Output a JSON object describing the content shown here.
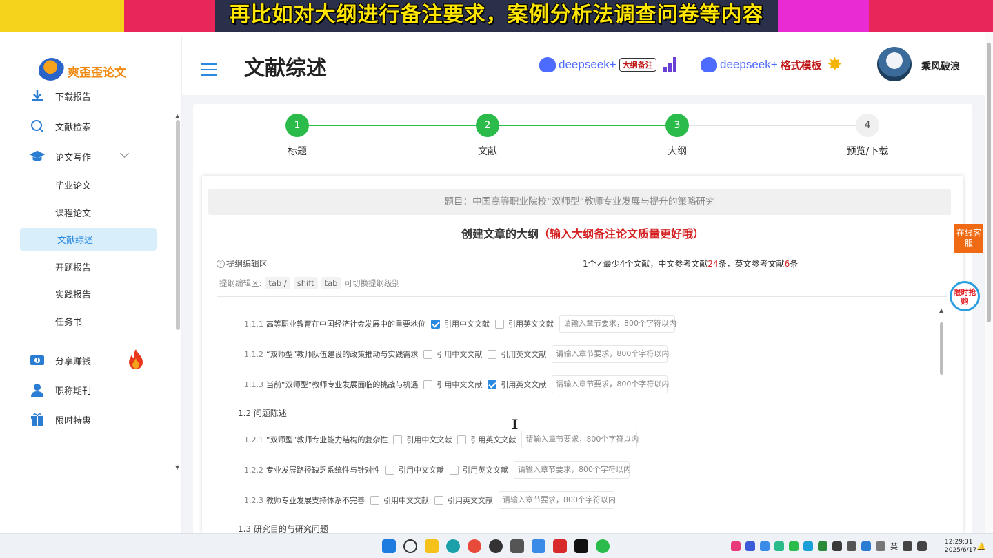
{
  "banner": {
    "caption": "再比如对大纲进行备注要求，案例分析法调查问卷等内容"
  },
  "sidebar": {
    "logo_text": "爽歪歪论文",
    "items": [
      {
        "label": "下载报告",
        "icon": "download-icon"
      },
      {
        "label": "文献检索",
        "icon": "search-icon"
      },
      {
        "label": "论文写作",
        "icon": "graduation-cap-icon"
      }
    ],
    "sub_items": [
      {
        "label": "毕业论文"
      },
      {
        "label": "课程论文"
      },
      {
        "label": "文献综述",
        "active": true
      },
      {
        "label": "开题报告"
      },
      {
        "label": "实践报告"
      },
      {
        "label": "任务书"
      }
    ],
    "bottom_items": [
      {
        "label": "分享赚钱",
        "icon": "money-icon"
      },
      {
        "label": "职称期刊",
        "icon": "user-icon"
      },
      {
        "label": "限时特惠",
        "icon": "gift-icon"
      }
    ]
  },
  "header": {
    "title": "文献综述",
    "badge1": {
      "brand": "deepseek+",
      "tag": "大纲备注"
    },
    "badge2": {
      "brand": "deepseek+",
      "tag": "格式模板"
    },
    "username": "乘风破浪"
  },
  "steps": [
    {
      "num": "1",
      "label": "标题",
      "done": true
    },
    {
      "num": "2",
      "label": "文献",
      "done": true
    },
    {
      "num": "3",
      "label": "大纲",
      "done": true
    },
    {
      "num": "4",
      "label": "预览/下载",
      "done": false
    }
  ],
  "topic": "题目：中国高等职业院校“双师型”教师专业发展与提升的策略研究",
  "create": {
    "title": "创建文章的大纲",
    "note": "（输入大纲备注论文质量更好哦）"
  },
  "editor": {
    "label": "提纲编辑区",
    "ref_count": {
      "p1": "1个✓最少4个文献，中文参考文献",
      "cn": "24",
      "p2": "条，英文参考文献",
      "en": "6",
      "p3": "条"
    },
    "hint_prefix": "提纲编辑区:",
    "hint_key1": "tab /",
    "hint_key2": "shift",
    "hint_key3": "tab",
    "hint_suffix": "可切换提纲级别"
  },
  "labels": {
    "cite_cn": "引用中文文献",
    "cite_en": "引用英文文献",
    "placeholder": "请输入章节要求，800个字符以内"
  },
  "outline": [
    {
      "num": "1.1.1",
      "title": "高等职业教育在中国经济社会发展中的重要地位",
      "cn": true,
      "en": false
    },
    {
      "num": "1.1.2",
      "title": "“双师型”教师队伍建设的政策推动与实践需求",
      "cn": false,
      "en": false
    },
    {
      "num": "1.1.3",
      "title": "当前“双师型”教师专业发展面临的挑战与机遇",
      "cn": false,
      "en": true
    },
    {
      "section": "1.2 问题陈述"
    },
    {
      "num": "1.2.1",
      "title": "“双师型”教师专业能力结构的复杂性",
      "cn": false,
      "en": false
    },
    {
      "num": "1.2.2",
      "title": "专业发展路径缺乏系统性与针对性",
      "cn": false,
      "en": false
    },
    {
      "num": "1.2.3",
      "title": "教师专业发展支持体系不完善",
      "cn": false,
      "en": false
    },
    {
      "section": "1.3 研究目的与研究问题"
    }
  ],
  "widgets": {
    "online": "在线客服",
    "limited": "限时抢购"
  },
  "taskbar": {
    "lang": "英",
    "time": "12:29:31",
    "date": "2025/6/17"
  }
}
